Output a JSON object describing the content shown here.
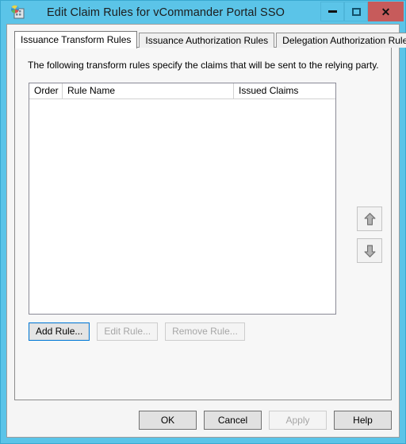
{
  "window": {
    "title": "Edit Claim Rules for vCommander Portal SSO",
    "icon": "adfs-console-icon",
    "controls": {
      "minimize": "minimize-icon",
      "maximize": "maximize-icon",
      "close": "✕"
    },
    "colors": {
      "chrome": "#5bc4e8",
      "close_button": "#c75b5b",
      "dialog_face": "#f5f5f5",
      "focus_outline": "#0078d7"
    }
  },
  "tabs": [
    {
      "label": "Issuance Transform Rules",
      "active": true
    },
    {
      "label": "Issuance Authorization Rules",
      "active": false
    },
    {
      "label": "Delegation Authorization Rules",
      "active": false
    }
  ],
  "panel": {
    "description": "The following transform rules specify the claims that will be sent to the relying party.",
    "list": {
      "columns": [
        "Order",
        "Rule Name",
        "Issued Claims"
      ],
      "rows": []
    },
    "reorder": {
      "move_up": "⬆",
      "move_down": "⬇",
      "move_up_enabled": false,
      "move_down_enabled": false
    },
    "rule_buttons": [
      {
        "label": "Add Rule...",
        "enabled": true,
        "focused": true
      },
      {
        "label": "Edit Rule...",
        "enabled": false,
        "focused": false
      },
      {
        "label": "Remove Rule...",
        "enabled": false,
        "focused": false
      }
    ]
  },
  "footer": {
    "buttons": [
      {
        "label": "OK",
        "enabled": true
      },
      {
        "label": "Cancel",
        "enabled": true
      },
      {
        "label": "Apply",
        "enabled": false
      },
      {
        "label": "Help",
        "enabled": true
      }
    ]
  }
}
